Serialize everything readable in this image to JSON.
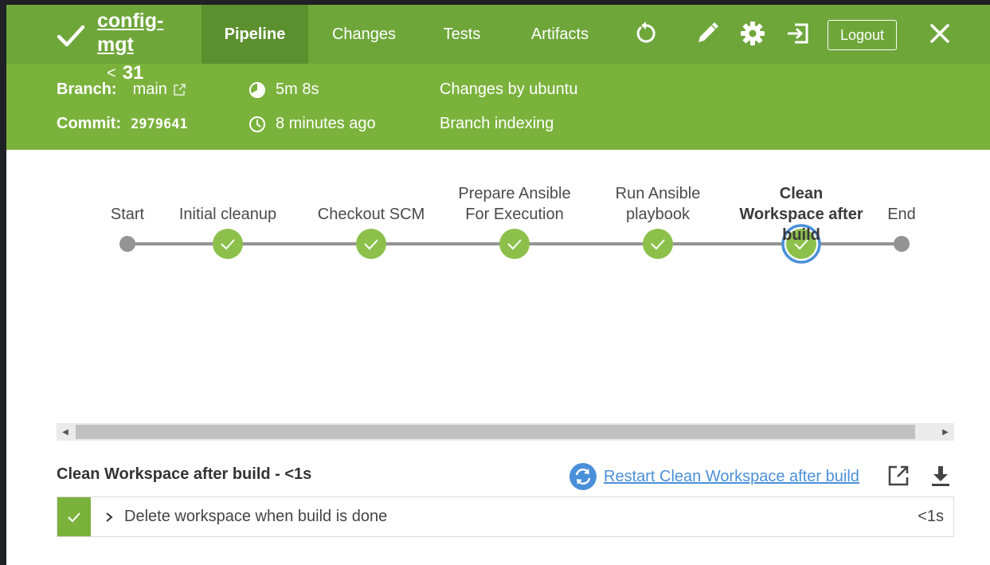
{
  "header": {
    "job_name": "config-mgt",
    "build_number": "31",
    "tabs": [
      {
        "label": "Pipeline",
        "active": true
      },
      {
        "label": "Changes",
        "active": false
      },
      {
        "label": "Tests",
        "active": false
      },
      {
        "label": "Artifacts",
        "active": false
      }
    ],
    "logout_label": "Logout",
    "icons": [
      "replay-icon",
      "edit-icon",
      "settings-icon",
      "open-classic-icon",
      "close-icon"
    ]
  },
  "info": {
    "branch_label": "Branch:",
    "branch_value": "main",
    "commit_label": "Commit:",
    "commit_value": "2979641",
    "duration": "5m 8s",
    "time_ago": "8 minutes ago",
    "changes": "Changes by ubuntu",
    "cause": "Branch indexing"
  },
  "pipeline": {
    "stages": [
      {
        "label": "Start",
        "state": "start"
      },
      {
        "label": "Initial cleanup",
        "state": "success"
      },
      {
        "label": "Checkout SCM",
        "state": "success"
      },
      {
        "label": "Prepare Ansible For Execution",
        "state": "success"
      },
      {
        "label": "Run Ansible playbook",
        "state": "success"
      },
      {
        "label": "Clean Workspace after build",
        "state": "success",
        "selected": true
      },
      {
        "label": "End",
        "state": "end"
      }
    ]
  },
  "detail": {
    "title": "Clean Workspace after build - <1s",
    "restart_label": "Restart Clean Workspace after build",
    "steps": [
      {
        "label": "Delete workspace when build is done",
        "duration": "<1s",
        "status": "success"
      }
    ]
  },
  "colors": {
    "topbar": "#6ea63a",
    "infobar": "#7bb23c",
    "success": "#8cc04b",
    "selected_ring": "#4a90d9",
    "node_gray": "#949494"
  }
}
